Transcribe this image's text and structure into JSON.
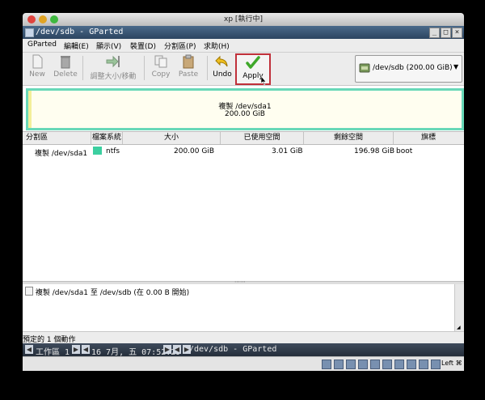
{
  "mac_window": {
    "title": "xp [執行中]"
  },
  "gparted_window": {
    "title": "/dev/sdb - GParted"
  },
  "menu": [
    "GParted",
    "編輯(E)",
    "顯示(V)",
    "裝置(D)",
    "分割區(P)",
    "求助(H)"
  ],
  "toolbar": {
    "new": "New",
    "delete": "Delete",
    "resize_move": "調整大小/移動",
    "copy": "Copy",
    "paste": "Paste",
    "undo": "Undo",
    "apply": "Apply"
  },
  "device_selector": {
    "label": "/dev/sdb  (200.00 GiB)"
  },
  "graph": {
    "partition_name": "複製 /dev/sda1",
    "partition_size": "200.00 GiB",
    "fs_color": "#68d8b8"
  },
  "table": {
    "headers": [
      "分割區",
      "檔案系統",
      "大小",
      "已使用空間",
      "剩餘空間",
      "旗標"
    ],
    "rows": [
      {
        "partition": "複製 /dev/sda1",
        "filesystem": "ntfs",
        "fs_color": "#3ccfa0",
        "size": "200.00 GiB",
        "used": "3.01 GiB",
        "unused": "196.98 GiB",
        "flags": "boot"
      }
    ]
  },
  "operations": {
    "items": [
      "複製 /dev/sda1 至 /dev/sdb (在 0.00 B 開始)"
    ]
  },
  "status": {
    "text": "預定的 1 個動作"
  },
  "taskbar": {
    "workspace": "工作區 1",
    "datetime": "16 7月, 五 07:52:29",
    "window": "/dev/sdb - GParted"
  },
  "bottombar": {
    "host_key": "Left ⌘"
  }
}
